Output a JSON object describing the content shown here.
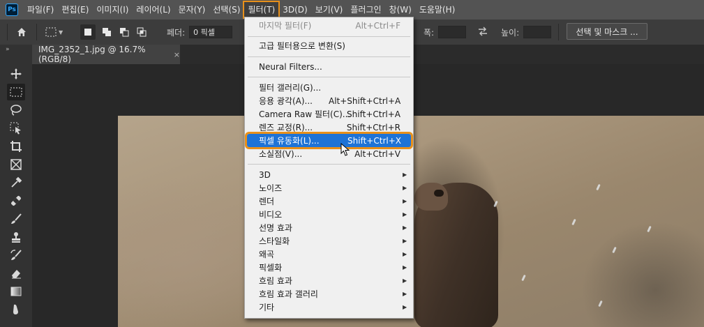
{
  "app": {
    "logo": "Ps"
  },
  "menubar": {
    "items": [
      "파일(F)",
      "편집(E)",
      "이미지(I)",
      "레이어(L)",
      "문자(Y)",
      "선택(S)",
      "필터(T)",
      "3D(D)",
      "보기(V)",
      "플러그인",
      "창(W)",
      "도움말(H)"
    ],
    "active_index": 6
  },
  "options": {
    "feather_label": "페더:",
    "feather_value": "0 픽셀",
    "width_label": "폭:",
    "height_label": "높이:",
    "mask_button": "선택 및 마스크 ..."
  },
  "document": {
    "tab_title": "IMG_2352_1.jpg @ 16.7% (RGB/8)",
    "close_glyph": "×"
  },
  "filter_menu": {
    "last_filter": {
      "label": "마지막 필터(F)",
      "shortcut": "Alt+Ctrl+F"
    },
    "smart_filter": {
      "label": "고급 필터용으로 변환(S)"
    },
    "neural": {
      "label": "Neural Filters..."
    },
    "items_main": [
      {
        "label": "필터 갤러리(G)...",
        "shortcut": ""
      },
      {
        "label": "응용 광각(A)...",
        "shortcut": "Alt+Shift+Ctrl+A"
      },
      {
        "label": "Camera Raw 필터(C)...",
        "shortcut": "Shift+Ctrl+A"
      },
      {
        "label": "렌즈 교정(R)...",
        "shortcut": "Shift+Ctrl+R"
      },
      {
        "label": "픽셀 유동화(L)...",
        "shortcut": "Shift+Ctrl+X"
      },
      {
        "label": "소실점(V)...",
        "shortcut": "Alt+Ctrl+V"
      }
    ],
    "highlight_index": 4,
    "submenus": [
      "3D",
      "노이즈",
      "렌더",
      "비디오",
      "선명 효과",
      "스타일화",
      "왜곡",
      "픽셀화",
      "흐림 효과",
      "흐림 효과 갤러리",
      "기타"
    ],
    "submenu_arrow": "▶"
  },
  "icons": {
    "home": "home-icon",
    "marquee": "rect-marquee-icon",
    "cursor": "arrow-cursor-icon"
  },
  "colors": {
    "accent_outline": "#e8901a",
    "highlight": "#1e73d6",
    "menubar": "#535353"
  }
}
